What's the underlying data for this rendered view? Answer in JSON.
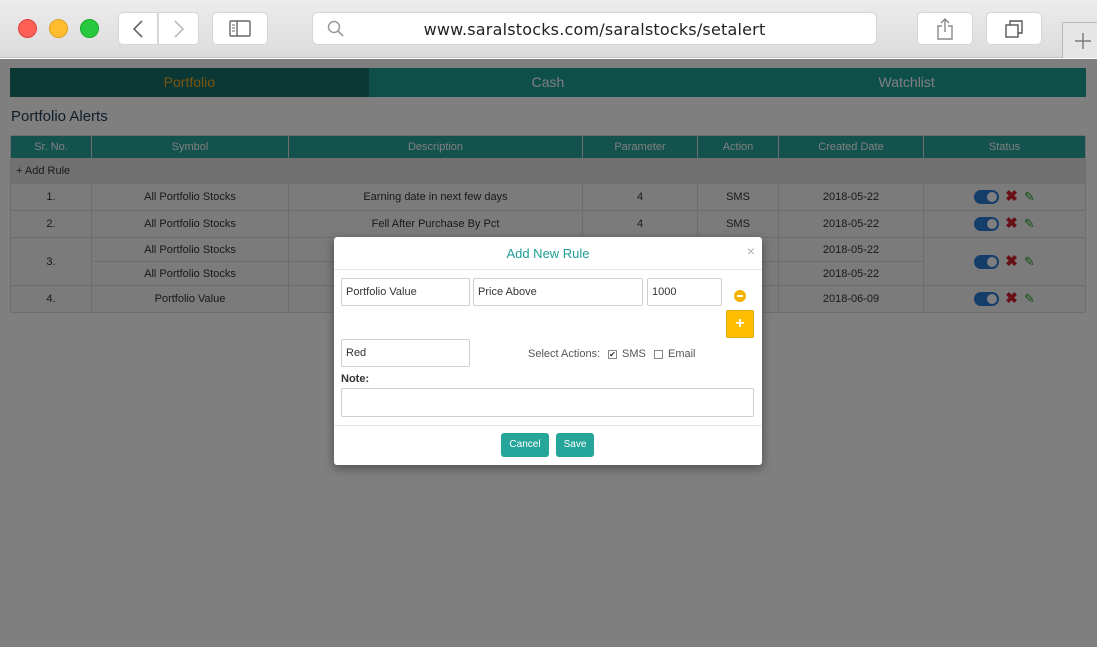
{
  "browser": {
    "url": "www.saralstocks.com/saralstocks/setalert"
  },
  "tabs": [
    "Portfolio",
    "Cash",
    "Watchlist"
  ],
  "section_title": "Portfolio Alerts",
  "table": {
    "headers": [
      "Sr. No.",
      "Symbol",
      "Description",
      "Parameter",
      "Action",
      "Created Date",
      "Status"
    ],
    "add_rule": "+ Add Rule",
    "rows": [
      {
        "sr": "1.",
        "symbol": "All Portfolio Stocks",
        "description": "Earning date in next few days",
        "parameter": "4",
        "action": "SMS",
        "date": "2018-05-22"
      },
      {
        "sr": "2.",
        "symbol": "All Portfolio Stocks",
        "description": "Fell After Purchase By Pct",
        "parameter": "4",
        "action": "SMS",
        "date": "2018-05-22"
      },
      {
        "sr": "3.",
        "symbol": "All Portfolio Stocks",
        "symbol2": "All Portfolio Stocks",
        "date": "2018-05-22",
        "date2": "2018-05-22"
      },
      {
        "sr": "4.",
        "symbol": "Portfolio Value",
        "date": "2018-06-09"
      }
    ]
  },
  "modal": {
    "title": "Add New Rule",
    "close": "×",
    "field_metric": "Portfolio Value",
    "field_condition": "Price Above",
    "field_value": "1000",
    "field_color": "Red",
    "select_actions_label": "Select Actions:",
    "sms_label": "SMS",
    "email_label": "Email",
    "sms_checked": true,
    "email_checked": false,
    "note_label": "Note:",
    "plus": "+",
    "cancel_label": "Cancel",
    "save_label": "Save"
  },
  "colors": {
    "teal": "#26a59a",
    "dark_teal": "#17716b",
    "active_tab_text": "#f2a91f",
    "toggle_blue": "#2a7bd3",
    "delete_red": "#d3212f",
    "edit_green": "#2aa12a",
    "add_yellow": "#ffbd00"
  }
}
